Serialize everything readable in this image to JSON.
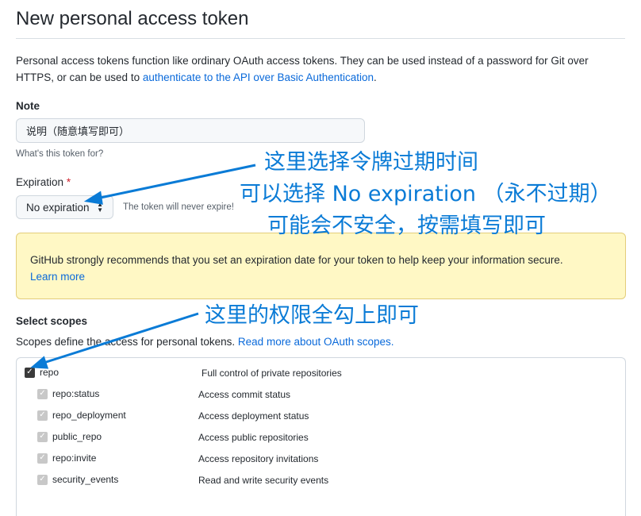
{
  "page": {
    "title": "New personal access token"
  },
  "intro": {
    "text": "Personal access tokens function like ordinary OAuth access tokens. They can be used instead of a password for Git over HTTPS, or can be used to ",
    "link": "authenticate to the API over Basic Authentication",
    "end": "."
  },
  "note": {
    "label": "Note",
    "value": "说明（随意填写即可）",
    "hint": "What's this token for?"
  },
  "expiration": {
    "label": "Expiration",
    "required_mark": "*",
    "selected": "No expiration",
    "hint": "The token will never expire!"
  },
  "flash": {
    "text": "GitHub strongly recommends that you set an expiration date for your token to help keep your information secure.",
    "link": "Learn more"
  },
  "scopes": {
    "heading": "Select scopes",
    "desc": "Scopes define the access for personal tokens. ",
    "link": "Read more about OAuth scopes.",
    "items": [
      {
        "name": "repo",
        "desc": "Full control of private repositories"
      },
      {
        "name": "repo:status",
        "desc": "Access commit status"
      },
      {
        "name": "repo_deployment",
        "desc": "Access deployment status"
      },
      {
        "name": "public_repo",
        "desc": "Access public repositories"
      },
      {
        "name": "repo:invite",
        "desc": "Access repository invitations"
      },
      {
        "name": "security_events",
        "desc": "Read and write security events"
      }
    ]
  },
  "annotations": {
    "line1": "这里选择令牌过期时间",
    "line2": "可以选择 No expiration （永不过期）",
    "line3": "可能会不安全，按需填写即可",
    "line4": "这里的权限全勾上即可",
    "color": "#0a7bd6"
  },
  "colors": {
    "link": "#0969da",
    "flash_bg": "#fff8c5",
    "required": "#cf222e"
  }
}
